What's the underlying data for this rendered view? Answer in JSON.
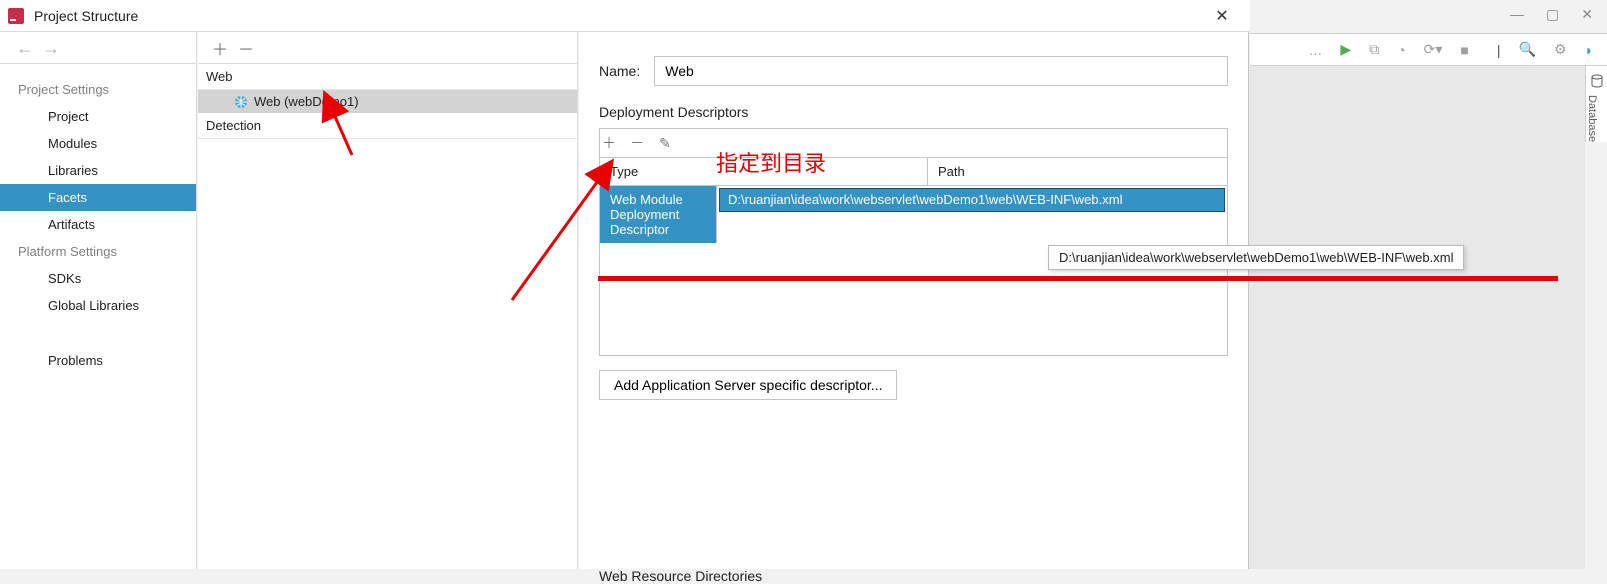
{
  "dialog": {
    "title": "Project Structure"
  },
  "sidebar": {
    "cat_project": "Project Settings",
    "items_project": [
      "Project",
      "Modules",
      "Libraries",
      "Facets",
      "Artifacts"
    ],
    "selected": "Facets",
    "cat_platform": "Platform Settings",
    "items_platform": [
      "SDKs",
      "Global Libraries"
    ],
    "problems": "Problems"
  },
  "tree": {
    "root": "Web",
    "child": "Web (webDemo1)",
    "detection": "Detection"
  },
  "details": {
    "name_label": "Name:",
    "name_value": "Web",
    "dd_header": "Deployment Descriptors",
    "col_type": "Type",
    "col_path": "Path",
    "row_type": "Web Module Deployment Descriptor",
    "row_path": "D:\\ruanjian\\idea\\work\\webservlet\\webDemo1\\web\\WEB-INF\\web.xml",
    "add_btn": "Add Application Server specific descriptor...",
    "wr_header": "Web Resource Directories"
  },
  "annotation": {
    "text": "指定到目录"
  },
  "tooltip": {
    "text": "D:\\ruanjian\\idea\\work\\webservlet\\webDemo1\\web\\WEB-INF\\web.xml"
  },
  "right_tab": {
    "label": "Database"
  }
}
